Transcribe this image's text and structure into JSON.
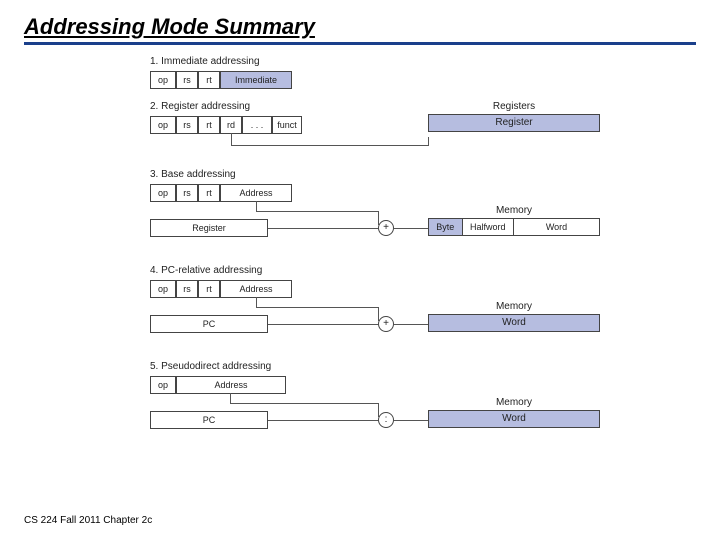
{
  "title": "Addressing Mode Summary",
  "footer": "CS 224 Fall 2011 Chapter 2c",
  "labels": {
    "op": "op",
    "rs": "rs",
    "rt": "rt",
    "rd": "rd",
    "dots": ". . .",
    "funct": "funct",
    "immediate": "Immediate",
    "address": "Address",
    "register": "Register",
    "registers": "Registers",
    "memory": "Memory",
    "pc": "PC",
    "byte": "Byte",
    "halfword": "Halfword",
    "word": "Word",
    "plus": "+",
    "concat": ":"
  },
  "modes": [
    {
      "num": "1.",
      "name": "Immediate addressing"
    },
    {
      "num": "2.",
      "name": "Register addressing"
    },
    {
      "num": "3.",
      "name": "Base addressing"
    },
    {
      "num": "4.",
      "name": "PC-relative addressing"
    },
    {
      "num": "5.",
      "name": "Pseudodirect addressing"
    }
  ]
}
